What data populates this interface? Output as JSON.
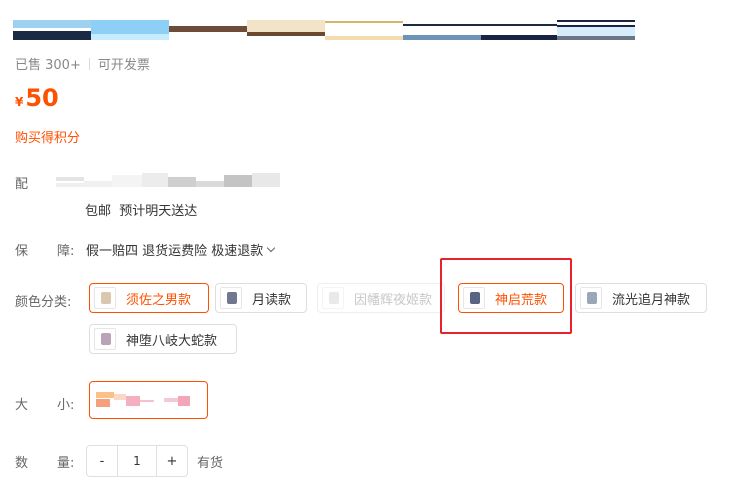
{
  "meta": {
    "sold": "已售 300+",
    "invoice": "可开发票"
  },
  "price": {
    "currency": "¥",
    "value": "50"
  },
  "points": "购买得积分",
  "shipping": {
    "label": "配",
    "text": "包邮  预计明天送达"
  },
  "guarantee": {
    "label_a": "保",
    "label_b": "障:",
    "text": "假一赔四 退货运费险 极速退款"
  },
  "color": {
    "label": "颜色分类:",
    "options": [
      {
        "label": "须佐之男款",
        "state": "selected"
      },
      {
        "label": "月读款",
        "state": "normal"
      },
      {
        "label": "因幡辉夜姬款",
        "state": "disabled"
      },
      {
        "label": "神启荒款",
        "state": "selected"
      },
      {
        "label": "流光追月神款",
        "state": "normal"
      },
      {
        "label": "神堕八岐大蛇款",
        "state": "normal"
      }
    ]
  },
  "size": {
    "label_a": "大",
    "label_b": "小:"
  },
  "quantity": {
    "label_a": "数",
    "label_b": "量:",
    "minus": "-",
    "value": "1",
    "plus": "+",
    "stock": "有货"
  },
  "colors": {
    "accent": "#ff5000",
    "highlight": "#e8212b"
  }
}
